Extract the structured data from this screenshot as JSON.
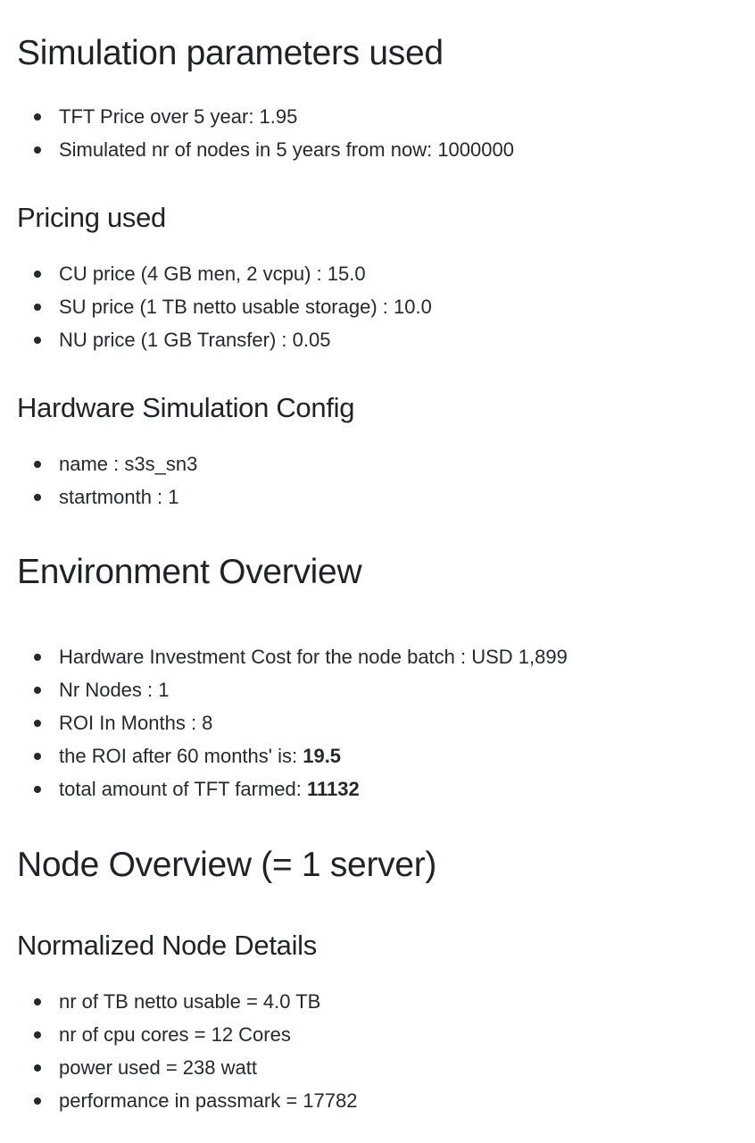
{
  "simulation": {
    "heading": "Simulation parameters used",
    "items": [
      "TFT Price over 5 year: 1.95",
      "Simulated nr of nodes in 5 years from now: 1000000"
    ]
  },
  "pricing": {
    "heading": "Pricing used",
    "items": [
      "CU price (4 GB men, 2 vcpu) : 15.0",
      "SU price (1 TB netto usable storage) : 10.0",
      "NU price (1 GB Transfer) : 0.05"
    ]
  },
  "hardware": {
    "heading": "Hardware Simulation Config",
    "items": [
      "name : s3s_sn3",
      "startmonth : 1"
    ]
  },
  "environment": {
    "heading": "Environment Overview",
    "items": [
      "Hardware Investment Cost for the node batch : USD 1,899",
      "Nr Nodes : 1",
      "ROI In Months : 8"
    ],
    "roi_label": "the ROI after 60 months' is: ",
    "roi_value": "19.5",
    "tft_label": "total amount of TFT farmed: ",
    "tft_value": "11132"
  },
  "node_overview": {
    "heading": "Node Overview (= 1 server)"
  },
  "normalized": {
    "heading": "Normalized Node Details",
    "items": [
      "nr of TB netto usable = 4.0 TB",
      "nr of cpu cores = 12 Cores",
      "power used = 238 watt",
      "performance in passmark = 17782"
    ]
  }
}
